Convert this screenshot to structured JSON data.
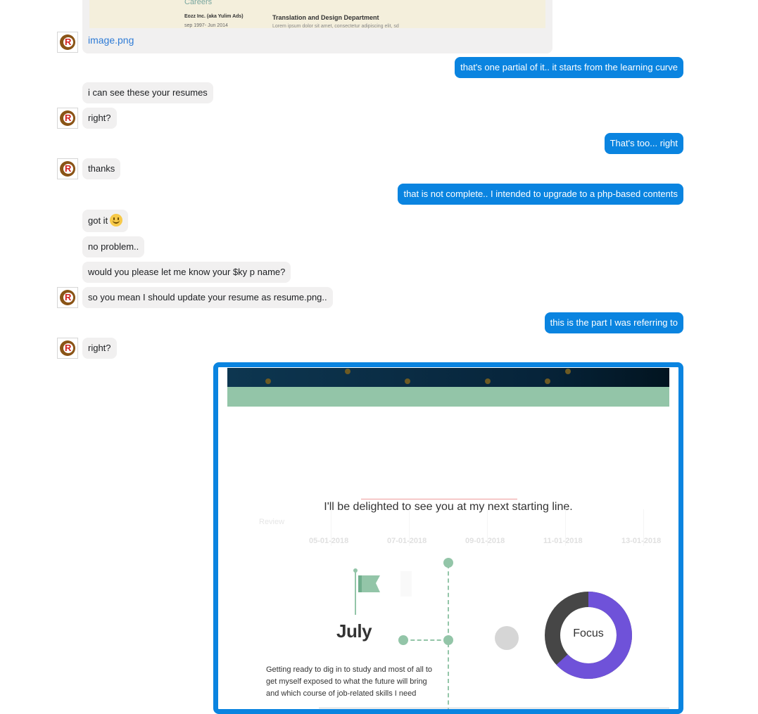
{
  "attachment": {
    "preview": {
      "section": "Careers",
      "company": "Eozz Inc. (aka Yulim Ads)",
      "dates": "sep 1997- Jun 2014",
      "department": "Translation and Design Department",
      "body": "Lorem ipsum dolor sit amet, consectetur adipiscing elit, sd"
    },
    "filename": "image.png"
  },
  "messages": [
    {
      "side": "out",
      "text": "that's one partial of it.. it starts from the learning curve"
    },
    {
      "side": "in",
      "text": "i can see these your resumes"
    },
    {
      "side": "in",
      "text": "right?"
    },
    {
      "side": "out",
      "text": "That's too... right"
    },
    {
      "side": "in",
      "text": "thanks"
    },
    {
      "side": "out",
      "text": "that is not complete.. I intended to upgrade to a php-based contents"
    },
    {
      "side": "in",
      "text": "got it"
    },
    {
      "side": "in",
      "text": "no problem.."
    },
    {
      "side": "in",
      "text": "would you please let me know your $ky p name?"
    },
    {
      "side": "in",
      "text": "so you mean I should update your resume as resume.png.."
    },
    {
      "side": "out",
      "text": "this is the part I was referring to"
    },
    {
      "side": "in",
      "text": "right?"
    }
  ],
  "avatar_letter": "R",
  "emoji": "slightly-smiling-face",
  "shared_image": {
    "tagline": "I'll be delighted to see you at my next starting line.",
    "review_label": "Review",
    "axis_dates": [
      "05-01-2018",
      "07-01-2018",
      "09-01-2018",
      "11-01-2018",
      "13-01-2018"
    ],
    "month": "July",
    "description": "Getting ready to dig in to study and most of all to get myself exposed to what the future will bring and which course of job-related skills I need",
    "donut_label": "Focus",
    "donut_fraction": 0.63,
    "colors": {
      "accent_green": "#93c5a8",
      "donut_purple": "#6f52d9",
      "donut_dark": "#464646"
    }
  },
  "colors": {
    "outgoing_bubble": "#0a84e0",
    "incoming_bubble": "#f1f0f0",
    "link": "#2e7bd6"
  }
}
